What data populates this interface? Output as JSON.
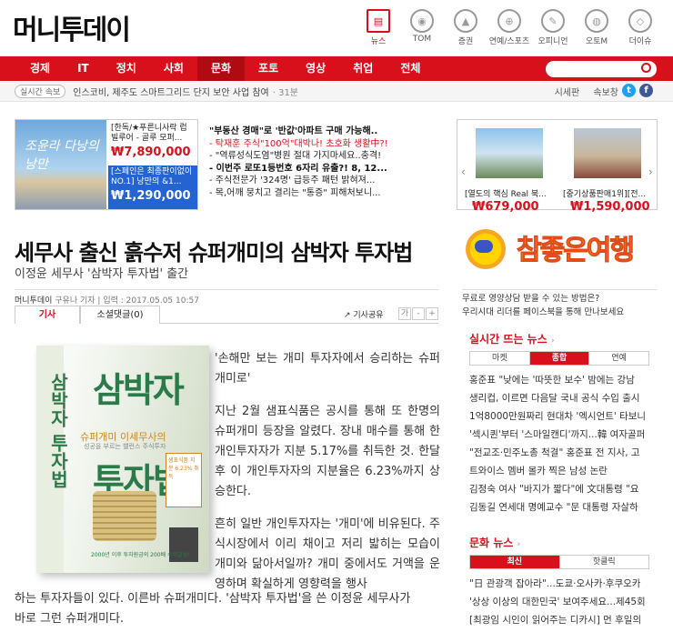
{
  "logo": "머니투데이",
  "top_icons": [
    {
      "label": "뉴스",
      "name": "news-icon"
    },
    {
      "label": "TOM",
      "name": "tom-icon"
    },
    {
      "label": "증권",
      "name": "stock-chart-icon"
    },
    {
      "label": "연예/스포츠",
      "name": "ball-icon"
    },
    {
      "label": "오피니언",
      "name": "pen-icon"
    },
    {
      "label": "오토M",
      "name": "car-icon"
    },
    {
      "label": "더이슈",
      "name": "diamond-icon"
    }
  ],
  "nav": [
    "경제",
    "IT",
    "정치",
    "사회",
    "문화",
    "포토",
    "영상",
    "취업",
    "전체"
  ],
  "breaking": {
    "label": "실시간 속보",
    "text": "인스코비, 제주도 스마트그리드 단지 보안 사업 참여",
    "time": "31분",
    "links": [
      "시세판",
      "속보창"
    ]
  },
  "ad_left": {
    "img_text": "조윤라 다낭의 낭만",
    "box1_text": "[한독/★푸른니사락 럽빌루어 - 골루 모퍼...",
    "box1_price": "₩7,890,000",
    "box2_text": "[스페인은 최종판이없이NO.1] 낭만의 &1...",
    "box2_price": "₩1,290,000"
  },
  "ad_list": [
    {
      "t": "\"부동산 경매\"로 '반값'아파트 구매 가능해..",
      "s": "b"
    },
    {
      "t": "- 탁재훈 주식\"100억\"대박나! 초호화 생활中?!",
      "s": "r"
    },
    {
      "t": "- \"역류성식도염\"병원 절대 가지마세요..충격!",
      "s": ""
    },
    {
      "t": "- 이번주 로또1등번호 6자리 유출?! 8, 12...",
      "s": "b"
    },
    {
      "t": "- 주식전문가 '324명' 급등주 패턴 밝혀져...",
      "s": ""
    },
    {
      "t": "- 목,어깨 뭉치고 결리는 \"통증\" 피해처보니...",
      "s": ""
    }
  ],
  "article": {
    "headline": "세무사 출신 흙수저 슈퍼개미의 삼박자 투자법",
    "subtitle": "이정윤 세무사 '삼박자 투자법' 출간",
    "source": "머니투데이",
    "reporter": "구유나 기자",
    "date_label": "입력 : 2017.05.05 10:57",
    "tab_article": "기사",
    "tab_comments": "소셜댓글(0)",
    "share": "기사공유",
    "font_buttons": [
      "가",
      "-",
      "+"
    ],
    "p1": "'손해만 보는 개미 투자자에서 승리하는 슈퍼개미로'",
    "p2": "지난 2월 샘표식품은 공시를 통해 또 한명의 슈퍼개미 등장을 알렸다. 장내 매수를 통해 한 개인투자자가 지분 5.17%를 취득한 것. 한달 후 이 개인투자자의 지분율은 6.23%까지 상승한다.",
    "p3a": "흔히 일반 개인투자자는 '개미'에 비유된다. 주식시장에서 이리 채이고 저리 밟히는 모습이 개미와 닮아서일까? 개미 중에서도 거액을 운영하며 확실하게 영향력을 행사",
    "p3b": "하는 투자자들이 있다. 이른바 슈퍼개미다. '삼박자 투자법'을 쓴 이정윤 세무사가",
    "p3c": "바로 그런 슈퍼개미다."
  },
  "book": {
    "spine": "삼박자 투자법",
    "title1": "삼박자",
    "subtitle": "슈퍼개미 이세무사의",
    "tagline": "성공을 부르는 밸런스 주식투자",
    "title2": "투자법",
    "sticker": "샘표식품 지분 6.23% 취득",
    "bottom": "2000년 이후 투자원금의 200배 수익달성!"
  },
  "ad_right": {
    "items": [
      {
        "caption": "[열도의 핵심 Real 북...",
        "price": "₩679,000"
      },
      {
        "caption": "[중기상품판매1위][전...",
        "price": "₩1,590,000"
      }
    ],
    "banner": "참좋은여행"
  },
  "right_links": [
    "무료로 영양상담 받을 수 있는 방법은?",
    "우리시대 리더를 페이스북을 통해 만나보세요"
  ],
  "live": {
    "title": "실시간 뜨는 뉴스",
    "tabs": [
      "마켓",
      "종합",
      "연예"
    ],
    "active": 1,
    "items": [
      "홍준표 \"낮에는 '따뜻한 보수' 밤에는 강남",
      "생리컵, 이르면 다음달 국내 공식 수입 출시",
      "1억8000만원짜리 현대차 '엑시언트' 타보니",
      "'섹시퀸'부터 '스마일캔디'까지...韓 여자골퍼",
      "\"전교조·민주노총 척결\" 홍준표 전 지사, 고",
      "트와이스 멤버 몰카 찍은 남성 논란",
      "김정숙 여사 \"바지가 짧다\"에 文대통령 \"요",
      "김동길 연세대 명예교수 \"문 대통령 자살하"
    ]
  },
  "culture": {
    "title": "문화 뉴스",
    "tabs": [
      "최신",
      "핫클릭"
    ],
    "active": 0,
    "items": [
      "\"日 관광객 잡아라\"...도쿄·오사카·후쿠오카",
      "'상상 이상의 대한민국' 보여주세요...제45회",
      "[최광임 시인이 읽어주는 디카시] 먼 후일의"
    ]
  }
}
